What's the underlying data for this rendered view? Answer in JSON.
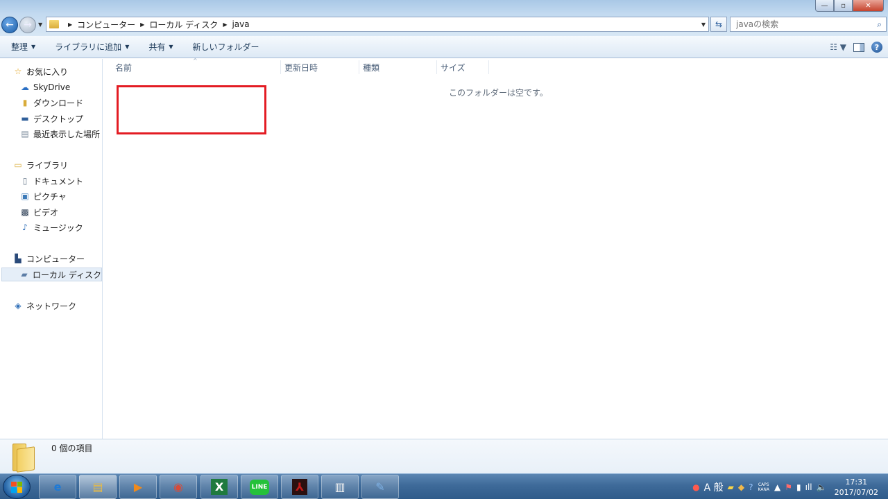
{
  "window": {
    "controls": {
      "minimize": "—",
      "maximize": "▫",
      "close": "✕"
    }
  },
  "address": {
    "crumbs": [
      "コンピューター",
      "ローカル ディスク",
      "java"
    ]
  },
  "search": {
    "placeholder": "javaの検索"
  },
  "toolbar": {
    "organize": "整理",
    "add_to_library": "ライブラリに追加",
    "share": "共有",
    "new_folder": "新しいフォルダー"
  },
  "nav": {
    "favorites": {
      "label": "お気に入り",
      "items": [
        "SkyDrive",
        "ダウンロード",
        "デスクトップ",
        "最近表示した場所"
      ]
    },
    "libraries": {
      "label": "ライブラリ",
      "items": [
        "ドキュメント",
        "ピクチャ",
        "ビデオ",
        "ミュージック"
      ]
    },
    "computer": {
      "label": "コンピューター",
      "items": [
        "ローカル ディスク"
      ]
    },
    "network": {
      "label": "ネットワーク"
    }
  },
  "columns": {
    "name": "名前",
    "modified": "更新日時",
    "type": "種類",
    "size": "サイズ"
  },
  "empty_message": "このフォルダーは空です。",
  "details": {
    "item_count": "0 個の項目"
  },
  "taskbar": {
    "apps": [
      {
        "name": "internet-explorer",
        "glyph": "e",
        "color": "#1e7ad6"
      },
      {
        "name": "file-explorer",
        "glyph": "▤",
        "color": "#e2b94a"
      },
      {
        "name": "media-player",
        "glyph": "▶",
        "color": "#f08a1c"
      },
      {
        "name": "chrome",
        "glyph": "◉",
        "color": "#d94a38"
      },
      {
        "name": "excel",
        "glyph": "X",
        "color": "#1f7a3e"
      },
      {
        "name": "line",
        "glyph": "LINE",
        "color": "#25c13a"
      },
      {
        "name": "acrobat",
        "glyph": "⅄",
        "color": "#c11a1a"
      },
      {
        "name": "notepad",
        "glyph": "▥",
        "color": "#f1f1f1"
      },
      {
        "name": "paint",
        "glyph": "✎",
        "color": "#7fb2e6"
      }
    ],
    "ime": "A 般",
    "caps": "CAPS",
    "kana": "KANA",
    "time": "17:31",
    "date": "2017/07/02"
  }
}
